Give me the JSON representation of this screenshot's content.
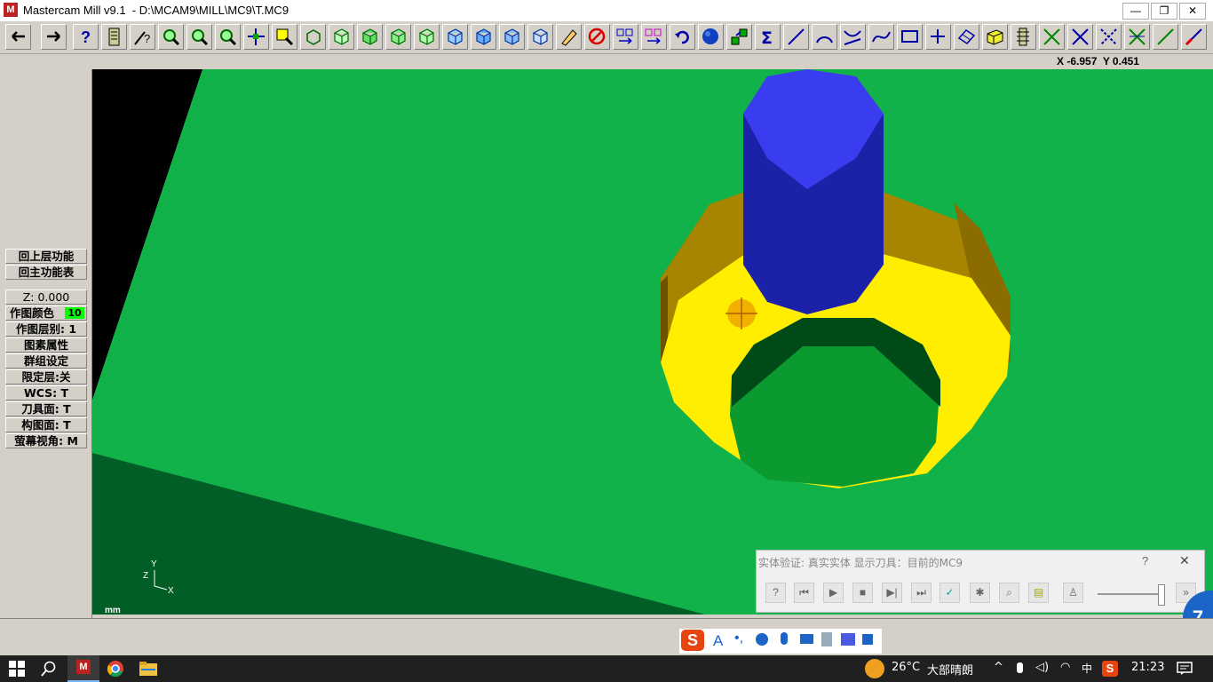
{
  "window": {
    "title": "Mastercam Mill v9.1  - D:\\MCAM9\\MILL\\MC9\\T.MC9",
    "logo_text": "M",
    "minimize_glyph": "—",
    "restore_glyph": "❐",
    "close_glyph": "✕"
  },
  "coords": {
    "readout": "X -6.957  Y 0.451"
  },
  "toolbar": {
    "icons": [
      "back-arrow-icon",
      "forward-arrow-icon",
      "help-icon",
      "notepad-icon",
      "analyze-icon",
      "zoom-window-icon",
      "zoom-out-icon",
      "zoom-previous-icon",
      "pan-icon",
      "select-zoom-icon",
      "rotate-icon",
      "cube-top-icon",
      "cube-front-icon",
      "cube-side-icon",
      "cube-iso-icon",
      "cube-blue-top-icon",
      "cube-blue-front-icon",
      "cube-blue-side-icon",
      "cube-blue-iso-icon",
      "eraser-icon",
      "delete-icon",
      "translate-icon",
      "copy-icon",
      "undo-icon",
      "shade-sphere-icon",
      "group-icon",
      "sum-icon",
      "line-icon",
      "arc-icon",
      "fillet-icon",
      "spline-icon",
      "rectangle-icon",
      "point-icon",
      "surface-icon",
      "solid-block-icon",
      "toolpath-icon",
      "x-trim-icon",
      "x-trim2-icon",
      "x-trim3-icon",
      "x-trim4-icon",
      "line-green-icon",
      "line-red-icon"
    ]
  },
  "left_menu": {
    "items": [
      {
        "label": "回上层功能"
      },
      {
        "label": "回主功能表"
      },
      {
        "label": "Z:  0.000"
      },
      {
        "label": "作图颜色",
        "badge": "10"
      },
      {
        "label": "作图层别: 1"
      },
      {
        "label": "图素属性"
      },
      {
        "label": "群组设定"
      },
      {
        "label": "限定层:关"
      },
      {
        "label": "WCS:  T"
      },
      {
        "label": "刀具面: T"
      },
      {
        "label": "构图面: T"
      },
      {
        "label": "萤幕视角: M"
      }
    ]
  },
  "viewport": {
    "units": "mm",
    "axis_z": "Z",
    "axis_y": "Y",
    "axis_x": "X"
  },
  "verify_dialog": {
    "title": "实体验证: 真实实体 显示刀具：目前的MC9",
    "help": "?",
    "close": "✕",
    "buttons": [
      "info-icon",
      "rewind-icon",
      "play-icon",
      "stop-icon",
      "step-icon",
      "fast-forward-icon",
      "check-icon",
      "settings-icon",
      "zoom-icon",
      "tool-icon",
      "figure-icon"
    ]
  },
  "taskbar": {
    "temperature": "26°C",
    "weather": "大部晴朗",
    "time": "21:23",
    "badge": "7"
  },
  "ime": {
    "label": "S"
  }
}
